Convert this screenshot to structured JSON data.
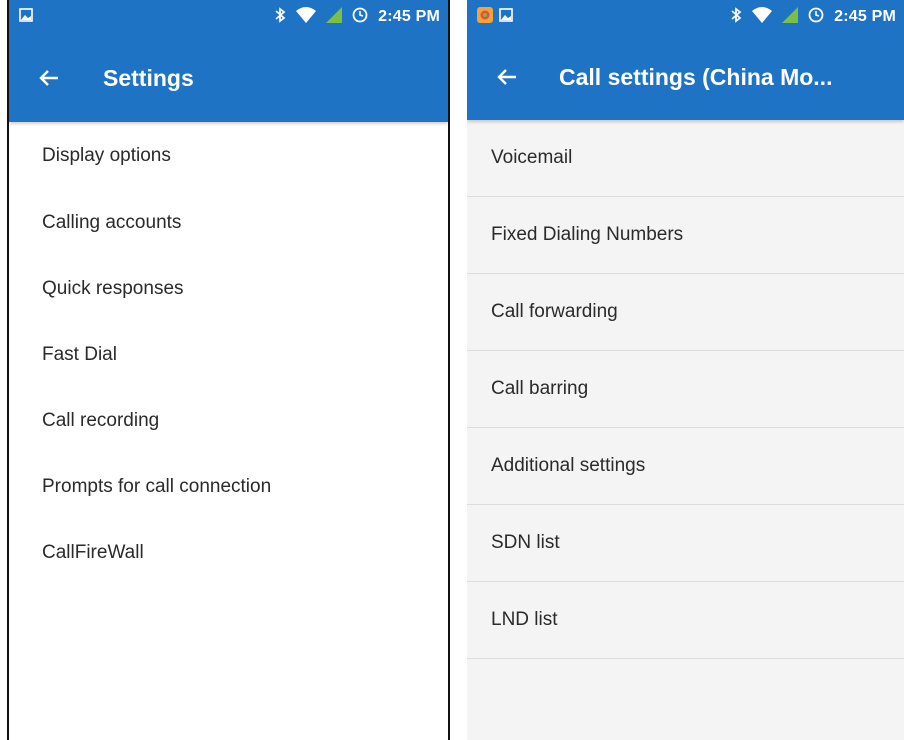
{
  "left_screen": {
    "status_bar": {
      "time": "2:45 PM",
      "icons": [
        "image-icon",
        "bluetooth-icon",
        "wifi-icon",
        "signal-icon",
        "alarm-icon"
      ]
    },
    "app_bar": {
      "back_icon": "arrow-left-icon",
      "title": "Settings"
    },
    "items": [
      {
        "label": "Display options"
      },
      {
        "label": "Calling accounts"
      },
      {
        "label": "Quick responses"
      },
      {
        "label": "Fast Dial"
      },
      {
        "label": "Call recording"
      },
      {
        "label": "Prompts for call connection"
      },
      {
        "label": "CallFireWall"
      }
    ]
  },
  "right_screen": {
    "status_bar": {
      "time": "2:45 PM",
      "icons": [
        "app-badge-icon",
        "image-icon",
        "bluetooth-icon",
        "wifi-icon",
        "signal-icon",
        "alarm-icon"
      ]
    },
    "app_bar": {
      "back_icon": "arrow-left-icon",
      "title": "Call settings (China Mo..."
    },
    "items": [
      {
        "label": "Voicemail"
      },
      {
        "label": "Fixed Dialing Numbers"
      },
      {
        "label": "Call forwarding"
      },
      {
        "label": "Call barring"
      },
      {
        "label": "Additional settings"
      },
      {
        "label": "SDN list"
      },
      {
        "label": "LND list"
      }
    ]
  },
  "colors": {
    "primary": "#1f73c5",
    "signal_green": "#7bc043",
    "text": "#2a2a2a",
    "divider": "#dcdcdc"
  }
}
